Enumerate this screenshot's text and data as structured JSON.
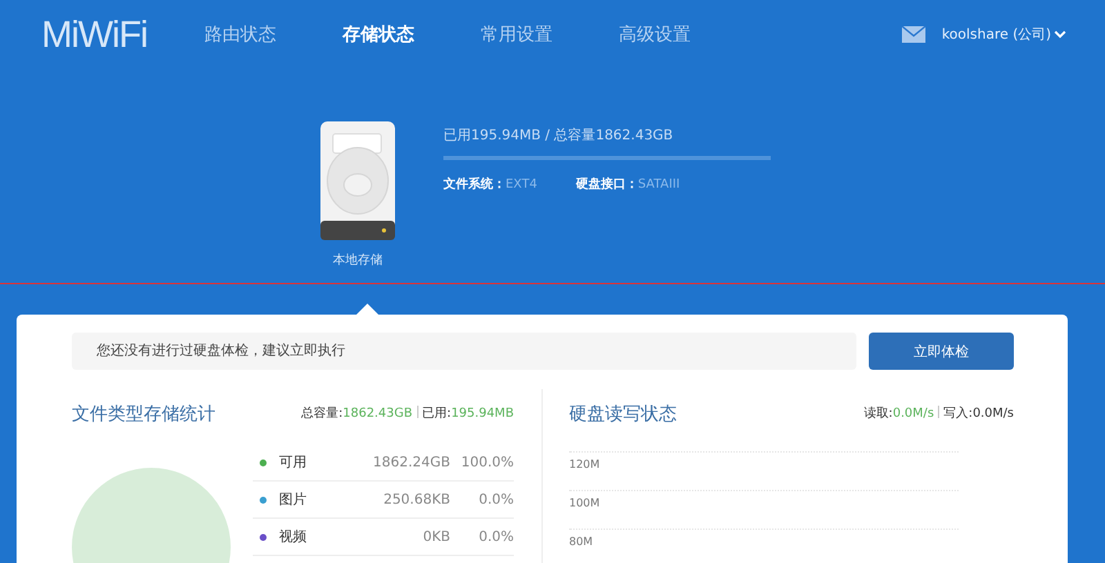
{
  "logo": "MiWiFi",
  "nav": [
    {
      "label": "路由状态",
      "selected": false
    },
    {
      "label": "存储状态",
      "selected": true
    },
    {
      "label": "常用设置",
      "selected": false
    },
    {
      "label": "高级设置",
      "selected": false
    }
  ],
  "user": {
    "name": "koolshare (公司)"
  },
  "disk": {
    "label": "本地存储",
    "usage": "已用195.94MB / 总容量1862.43GB",
    "level": 0.0,
    "details": [
      {
        "label": "文件系统：",
        "value": "EXT4"
      },
      {
        "label": "硬盘接口：",
        "value": "SATAIII"
      }
    ]
  },
  "notice": {
    "text": "您还没有进行过硬盘体检，建议立即执行",
    "button": "立即体检"
  },
  "storage_stats": {
    "title": "文件类型存储统计",
    "total_label": "总容量:",
    "total": "1862.43GB",
    "used_label": "已用:",
    "used": "195.94MB",
    "items": [
      {
        "name": "可用",
        "size": "1862.24GB",
        "percent": "100.0%",
        "color": "#4caf50"
      },
      {
        "name": "图片",
        "size": "250.68KB",
        "percent": "0.0%",
        "color": "#3a9fd0"
      },
      {
        "name": "视频",
        "size": "0KB",
        "percent": "0.0%",
        "color": "#6a4fc8"
      }
    ]
  },
  "io_status": {
    "title": "硬盘读写状态",
    "read_label": "读取:",
    "read": "0.0M/s",
    "write_label": "写入:",
    "write": "0.0M/s",
    "chart": {
      "y_labels": [
        "120M",
        "100M",
        "80M"
      ]
    }
  }
}
